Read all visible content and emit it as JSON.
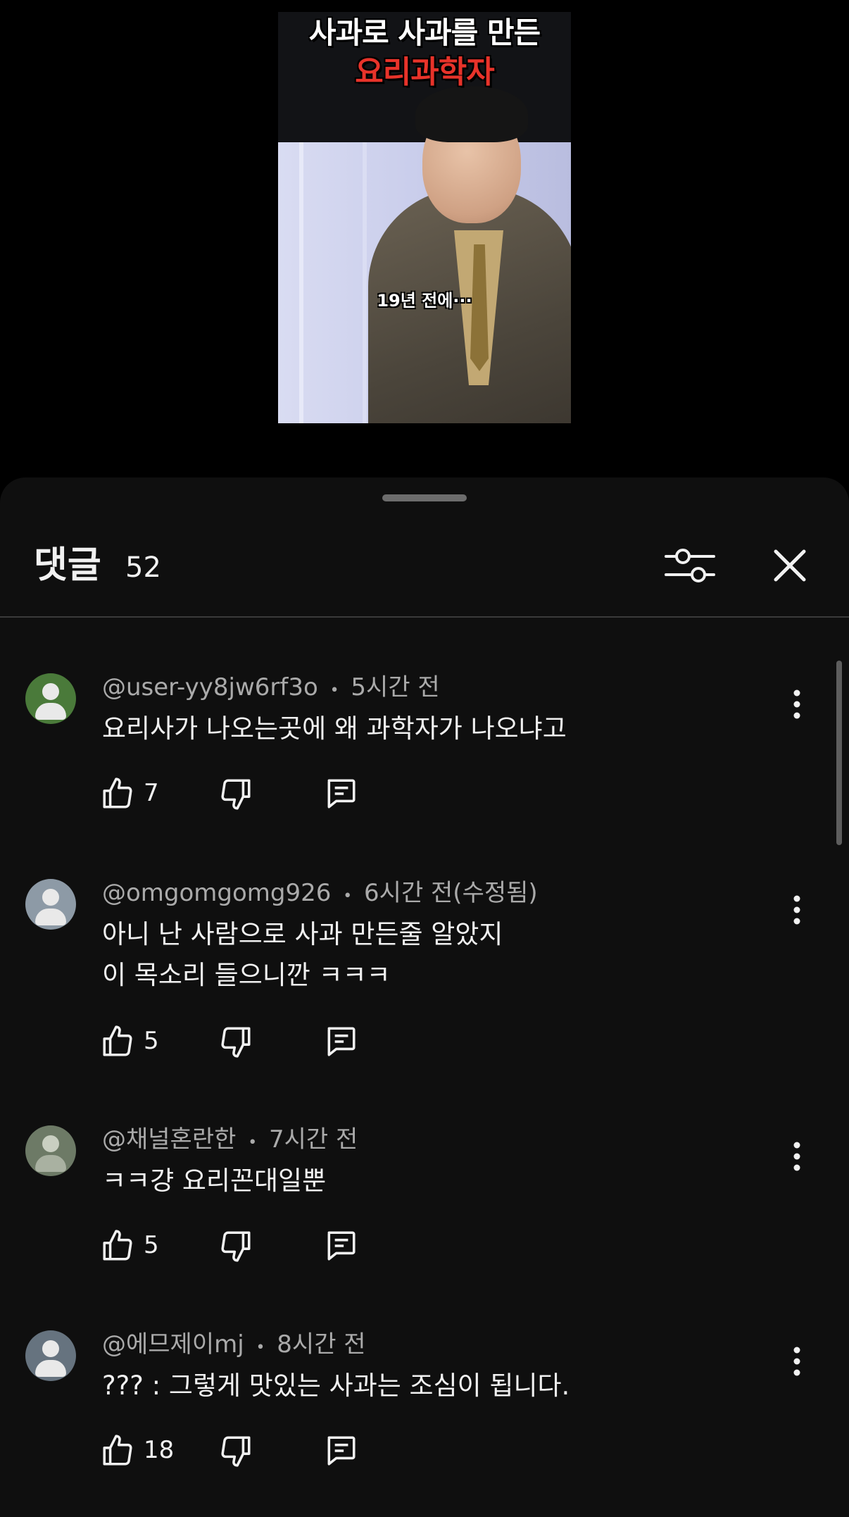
{
  "video": {
    "title_line1": "사과로 사과를 만든",
    "title_line2": "요리과학자",
    "caption": "19년 전에···"
  },
  "comments_sheet": {
    "title": "댓글",
    "count": "52",
    "comments": [
      {
        "author": "@user-yy8jw6rf3o",
        "time": "5시간 전",
        "text": "요리사가 나오는곳에 왜 과학자가 나오냐고",
        "likes": "7",
        "avatar_color": "#4a7a3a"
      },
      {
        "author": "@omgomgomg926",
        "time": "6시간 전(수정됨)",
        "text": "아니 난 사람으로 사과 만든줄 알았지\n이 목소리 들으니깐 ㅋㅋㅋ",
        "likes": "5",
        "avatar_color": "#8d9aa6"
      },
      {
        "author": "@채널혼란한",
        "time": "7시간 전",
        "text": "ㅋㅋ걍 요리꼰대일뿐",
        "likes": "5",
        "avatar_color": "#6d7a66"
      },
      {
        "author": "@에므제이mj",
        "time": "8시간 전",
        "text": "??? : 그렇게 맛있는 사과는 조심이 됩니다.",
        "likes": "18",
        "avatar_color": "#66737f"
      }
    ]
  },
  "meta_separator": "•",
  "colors": {
    "sheet_background": "#0f0f0f",
    "primary_text": "#f1f1f1",
    "secondary_text": "#aaaaaa",
    "video_title_red": "#e8332a"
  }
}
